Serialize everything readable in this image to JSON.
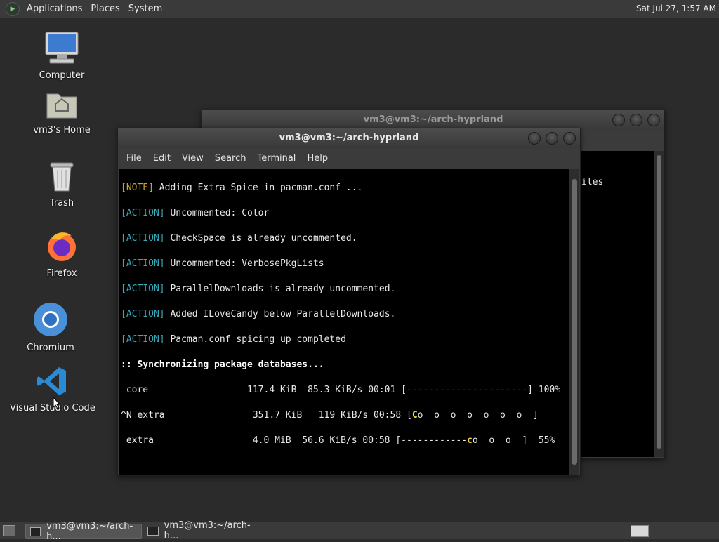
{
  "top_panel": {
    "menus": [
      "Applications",
      "Places",
      "System"
    ],
    "clock": "Sat Jul 27,  1:57 AM"
  },
  "desktop": {
    "icons": [
      {
        "label": "Computer",
        "icon": "computer-icon"
      },
      {
        "label": "vm3's Home",
        "icon": "home-folder-icon"
      },
      {
        "label": "Trash",
        "icon": "trash-icon"
      },
      {
        "label": "Firefox",
        "icon": "firefox-icon"
      },
      {
        "label": "Chromium",
        "icon": "chromium-icon"
      },
      {
        "label": "Visual Studio Code",
        "icon": "vscode-icon"
      }
    ]
  },
  "back_window": {
    "title": "vm3@vm3:~/arch-hyprland",
    "visible_text": "iles"
  },
  "front_window": {
    "title": "vm3@vm3:~/arch-hyprland",
    "menu": [
      "File",
      "Edit",
      "View",
      "Search",
      "Terminal",
      "Help"
    ],
    "lines": [
      {
        "tag": "[NOTE]",
        "text": " Adding Extra Spice in pacman.conf ..."
      },
      {
        "tag": "[ACTION]",
        "text": " Uncommented: Color"
      },
      {
        "tag": "[ACTION]",
        "text": " CheckSpace is already uncommented."
      },
      {
        "tag": "[ACTION]",
        "text": " Uncommented: VerbosePkgLists"
      },
      {
        "tag": "[ACTION]",
        "text": " ParallelDownloads is already uncommented."
      },
      {
        "tag": "[ACTION]",
        "text": " Added ILoveCandy below ParallelDownloads."
      },
      {
        "tag": "[ACTION]",
        "text": " Pacman.conf spicing up completed"
      }
    ],
    "sync_line": ":: Synchronizing package databases...",
    "downloads": [
      {
        "pre": " core                  117.4 KiB  85.3 KiB/s 00:01 [----------------------] 100%",
        "mid": "",
        "post": ""
      },
      {
        "pre": "^N extra                351.7 KiB   119 KiB/s 00:58 [",
        "mid": "C",
        "post": "o  o  o  o  o  o  o  ]"
      },
      {
        "pre": " extra                  4.0 MiB  56.6 KiB/s 00:58 [------------",
        "mid": "c",
        "post": "o  o  o  ]  55%"
      }
    ]
  },
  "bottom_panel": {
    "tasks": [
      "vm3@vm3:~/arch-h...",
      "vm3@vm3:~/arch-h..."
    ]
  },
  "colors": {
    "desktop_bg": "#2b2b2b",
    "note": "#c9a227",
    "action": "#3aa8b8",
    "pacman": "#f0d83c"
  }
}
